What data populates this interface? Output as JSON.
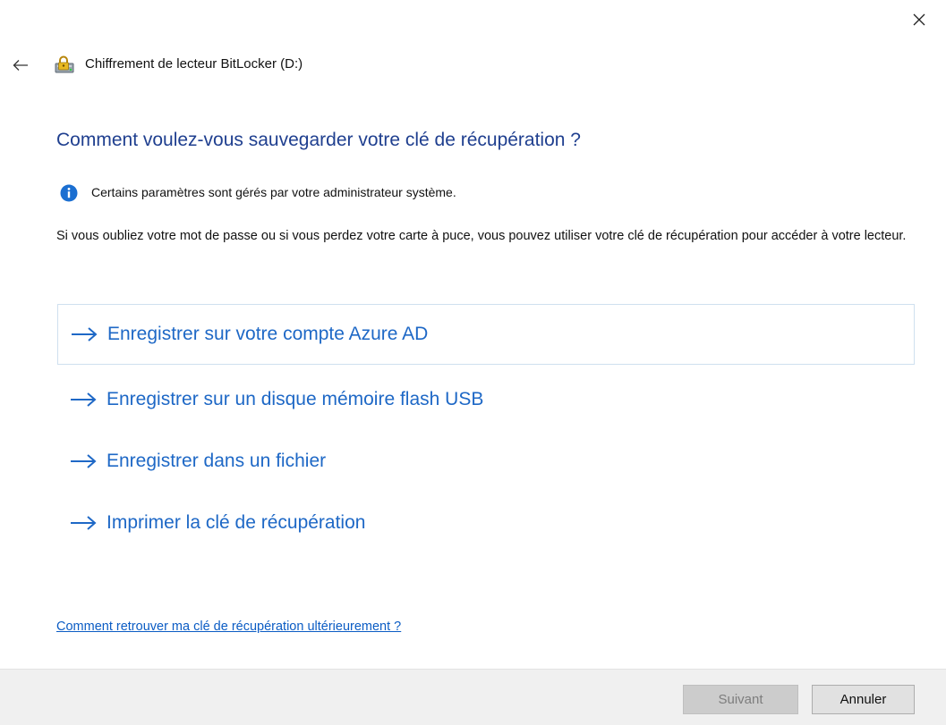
{
  "window": {
    "title": "Chiffrement de lecteur BitLocker (D:)",
    "icon": "bitlocker-drive-icon"
  },
  "heading": "Comment voulez-vous sauvegarder votre clé de récupération ?",
  "info": {
    "icon": "info-icon",
    "text": "Certains paramètres sont gérés par votre administrateur système."
  },
  "description": "Si vous oubliez votre mot de passe ou si vous perdez votre carte à puce, vous pouvez utiliser votre clé de récupération pour accéder à votre lecteur.",
  "options": [
    {
      "label": "Enregistrer sur votre compte Azure AD",
      "focused": true
    },
    {
      "label": "Enregistrer sur un disque mémoire flash USB",
      "focused": false
    },
    {
      "label": "Enregistrer dans un fichier",
      "focused": false
    },
    {
      "label": "Imprimer la clé de récupération",
      "focused": false
    }
  ],
  "help_link": "Comment retrouver ma clé de récupération ultérieurement ?",
  "buttons": {
    "next": {
      "label": "Suivant",
      "enabled": false
    },
    "cancel": {
      "label": "Annuler",
      "enabled": true
    }
  },
  "colors": {
    "heading": "#1f3f8f",
    "option_text": "#1e68c6",
    "link": "#0b5cc4",
    "info_icon": "#1b6fd1",
    "footer_bg": "#f0f0f0"
  }
}
